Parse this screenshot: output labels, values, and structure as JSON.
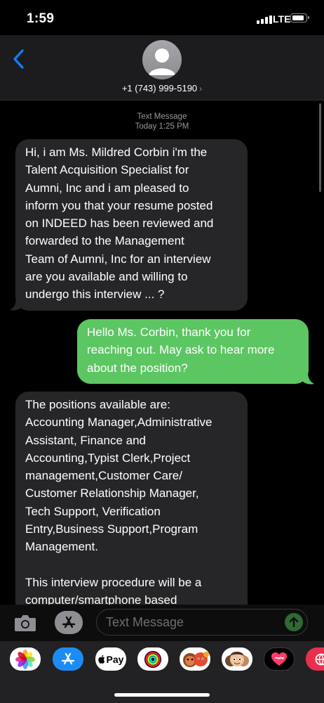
{
  "status_bar": {
    "time": "1:59",
    "network": "LTE"
  },
  "header": {
    "contact": "+1 (743) 999-5190",
    "chevron": "›"
  },
  "thread": {
    "service": "Text Message",
    "timestamp": "Today 1:25 PM",
    "messages": [
      {
        "direction": "incoming",
        "lines": [
          "Hi, i am Ms. Mildred Corbin i'm the",
          "Talent Acquisition Specialist for",
          "Aumni, Inc and i am pleased to",
          "inform you that your resume posted",
          "on INDEED has been reviewed and",
          "forwarded to the Management",
          "Team of Aumni, Inc for an interview",
          "are you available and willing to",
          "undergo this interview ... ?"
        ]
      },
      {
        "direction": "outgoing",
        "lines": [
          "Hello Ms. Corbin, thank you for",
          "reaching out. May ask to hear more",
          "about the position?"
        ]
      },
      {
        "direction": "incoming",
        "lines": [
          "The positions available are:",
          "Accounting Manager,Administrative",
          "Assistant, Finance and",
          "Accounting,Typist Clerk,Project",
          "management,Customer Care/",
          "Customer Relationship Manager,",
          "Tech Support, Verification",
          "Entry,Business Support,Program",
          "Management.",
          "",
          "This interview procedure will be a",
          "computer/smartphone based"
        ]
      }
    ]
  },
  "composer": {
    "placeholder": "Text Message"
  },
  "app_drawer": [
    {
      "name": "photos-icon"
    },
    {
      "name": "app-store-icon"
    },
    {
      "name": "apple-pay-icon",
      "label": "Pay"
    },
    {
      "name": "fitness-icon"
    },
    {
      "name": "animoji-icon"
    },
    {
      "name": "memoji-icon"
    },
    {
      "name": "digital-touch-icon"
    },
    {
      "name": "web-search-icon"
    }
  ],
  "colors": {
    "outgoing_bubble": "#5cc662",
    "incoming_bubble": "#262628",
    "accent_blue": "#0a84ff"
  }
}
